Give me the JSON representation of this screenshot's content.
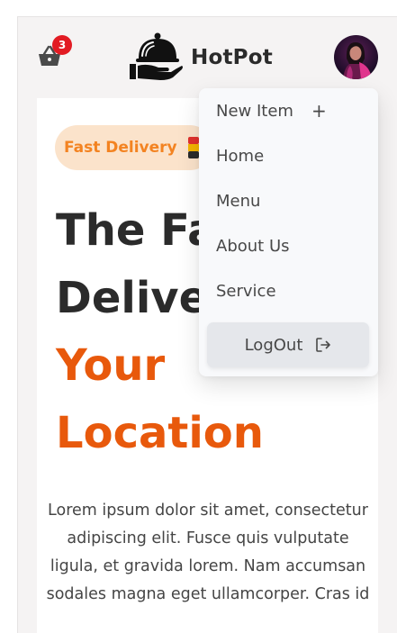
{
  "header": {
    "brand_name": "HotPot",
    "cart_count": "3",
    "cart_icon": "basket-icon",
    "logo_icon": "cloche-on-hand-icon"
  },
  "hero": {
    "badge_text": "Fast Delivery",
    "headline_line1": "The Fa",
    "headline_line2": "Delive",
    "headline_line3": "Your",
    "headline_line4": "Location",
    "description": "Lorem ipsum dolor sit amet, consectetur adipiscing elit. Fusce quis vulputate ligula, et gravida lorem. Nam accumsan sodales magna eget ullamcorper. Cras id"
  },
  "menu": {
    "items": [
      {
        "label": "New Item",
        "icon": "plus-icon"
      },
      {
        "label": "Home"
      },
      {
        "label": "Menu"
      },
      {
        "label": "About Us"
      },
      {
        "label": "Service"
      }
    ],
    "new_item_plus": "+",
    "logout_label": "LogOut",
    "logout_icon": "logout-icon"
  },
  "colors": {
    "brand_orange": "#e8590c",
    "badge_text": "#f38321",
    "badge_bg": "#fbe3cb",
    "cart_badge": "#e21b23",
    "text_dark": "#2b2b2b"
  }
}
